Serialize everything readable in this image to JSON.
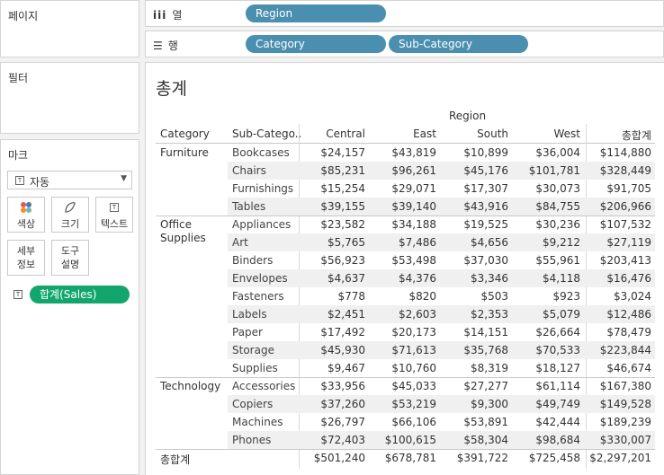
{
  "left_panel": {
    "pages_title": "페이지",
    "filters_title": "필터",
    "marks_title": "마크",
    "mark_type": "자동",
    "mark_buttons": [
      "색상",
      "크기",
      "텍스트",
      "세부\n정보",
      "도구\n설명"
    ],
    "text_pill": "합계(Sales)"
  },
  "shelves": {
    "columns_label": "열",
    "rows_label": "행",
    "column_pills": [
      "Region"
    ],
    "row_pills": [
      "Category",
      "Sub-Category"
    ]
  },
  "view": {
    "sheet_title": "총계",
    "region_header": "Region",
    "headers": [
      "Category",
      "Sub-Catego..",
      "Central",
      "East",
      "South",
      "West",
      "총합계"
    ],
    "grand_total_label": "총합계",
    "groups": [
      {
        "category": "Furniture",
        "rows": [
          {
            "sub": "Bookcases",
            "values": [
              "$24,157",
              "$43,819",
              "$10,899",
              "$36,004",
              "$114,880"
            ]
          },
          {
            "sub": "Chairs",
            "values": [
              "$85,231",
              "$96,261",
              "$45,176",
              "$101,781",
              "$328,449"
            ]
          },
          {
            "sub": "Furnishings",
            "values": [
              "$15,254",
              "$29,071",
              "$17,307",
              "$30,073",
              "$91,705"
            ]
          },
          {
            "sub": "Tables",
            "values": [
              "$39,155",
              "$39,140",
              "$43,916",
              "$84,755",
              "$206,966"
            ]
          }
        ]
      },
      {
        "category": "Office Supplies",
        "rows": [
          {
            "sub": "Appliances",
            "values": [
              "$23,582",
              "$34,188",
              "$19,525",
              "$30,236",
              "$107,532"
            ]
          },
          {
            "sub": "Art",
            "values": [
              "$5,765",
              "$7,486",
              "$4,656",
              "$9,212",
              "$27,119"
            ]
          },
          {
            "sub": "Binders",
            "values": [
              "$56,923",
              "$53,498",
              "$37,030",
              "$55,961",
              "$203,413"
            ]
          },
          {
            "sub": "Envelopes",
            "values": [
              "$4,637",
              "$4,376",
              "$3,346",
              "$4,118",
              "$16,476"
            ]
          },
          {
            "sub": "Fasteners",
            "values": [
              "$778",
              "$820",
              "$503",
              "$923",
              "$3,024"
            ]
          },
          {
            "sub": "Labels",
            "values": [
              "$2,451",
              "$2,603",
              "$2,353",
              "$5,079",
              "$12,486"
            ]
          },
          {
            "sub": "Paper",
            "values": [
              "$17,492",
              "$20,173",
              "$14,151",
              "$26,664",
              "$78,479"
            ]
          },
          {
            "sub": "Storage",
            "values": [
              "$45,930",
              "$71,613",
              "$35,768",
              "$70,533",
              "$223,844"
            ]
          },
          {
            "sub": "Supplies",
            "values": [
              "$9,467",
              "$10,760",
              "$8,319",
              "$18,127",
              "$46,674"
            ]
          }
        ]
      },
      {
        "category": "Technology",
        "rows": [
          {
            "sub": "Accessories",
            "values": [
              "$33,956",
              "$45,033",
              "$27,277",
              "$61,114",
              "$167,380"
            ]
          },
          {
            "sub": "Copiers",
            "values": [
              "$37,260",
              "$53,219",
              "$9,300",
              "$49,749",
              "$149,528"
            ]
          },
          {
            "sub": "Machines",
            "values": [
              "$26,797",
              "$66,106",
              "$53,891",
              "$42,444",
              "$189,239"
            ]
          },
          {
            "sub": "Phones",
            "values": [
              "$72,403",
              "$100,615",
              "$58,304",
              "$98,684",
              "$330,007"
            ]
          }
        ]
      }
    ],
    "grand_total_values": [
      "$501,240",
      "$678,781",
      "$391,722",
      "$725,458",
      "$2,297,201"
    ]
  },
  "colors": {
    "pill_blue": "#4a8fb0",
    "pill_green": "#12a66d",
    "band_gray": "#f0f0f0"
  }
}
